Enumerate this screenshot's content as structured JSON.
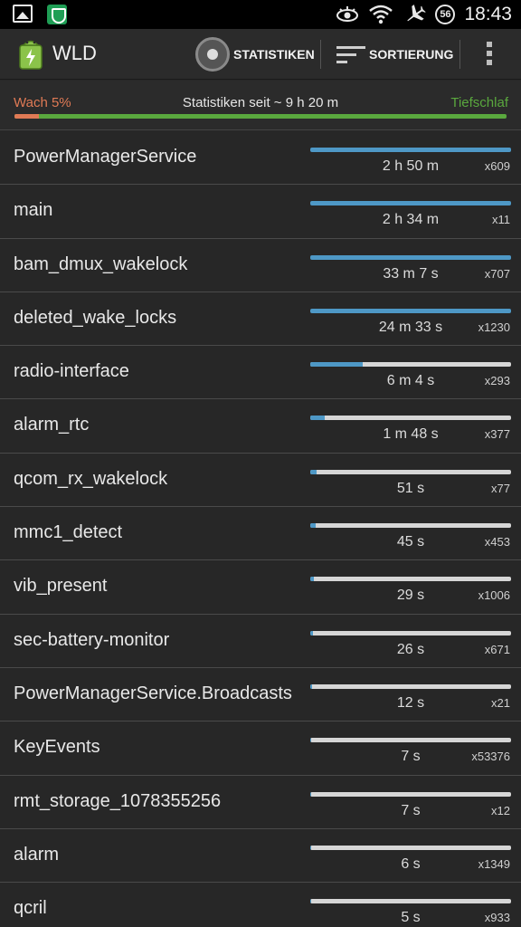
{
  "status_bar": {
    "time": "18:43",
    "badge": "56",
    "icons": [
      "image-icon",
      "shield-app-icon",
      "eye-icon",
      "wifi-icon",
      "airplane-icon"
    ]
  },
  "action_bar": {
    "title": "WLD",
    "statistics_label": "STATISTIKEN",
    "sort_label": "SORTIERUNG",
    "icons": [
      "battery-app-icon",
      "disc-icon",
      "sort-icon",
      "overflow-menu-icon"
    ]
  },
  "summary": {
    "awake_label": "Wach 5%",
    "since_label": "Statistiken seit ~ 9 h 20 m",
    "deep_sleep_label": "Tiefschlaf",
    "awake_fraction": 0.05,
    "colors": {
      "awake": "#e07a55",
      "deep_sleep": "#5aa83e",
      "progress": "#4e98c6"
    }
  },
  "wakelocks": [
    {
      "name": "PowerManagerService",
      "time": "2 h 50 m",
      "count": "x609",
      "fraction": 1.0
    },
    {
      "name": "main",
      "time": "2 h 34 m",
      "count": "x11",
      "fraction": 1.0
    },
    {
      "name": "bam_dmux_wakelock",
      "time": "33 m 7 s",
      "count": "x707",
      "fraction": 1.0
    },
    {
      "name": "deleted_wake_locks",
      "time": "24 m 33 s",
      "count": "x1230",
      "fraction": 1.0
    },
    {
      "name": "radio-interface",
      "time": "6 m 4 s",
      "count": "x293",
      "fraction": 0.26
    },
    {
      "name": "alarm_rtc",
      "time": "1 m 48 s",
      "count": "x377",
      "fraction": 0.07
    },
    {
      "name": "qcom_rx_wakelock",
      "time": "51 s",
      "count": "x77",
      "fraction": 0.03
    },
    {
      "name": "mmc1_detect",
      "time": "45 s",
      "count": "x453",
      "fraction": 0.025
    },
    {
      "name": "vib_present",
      "time": "29 s",
      "count": "x1006",
      "fraction": 0.02
    },
    {
      "name": "sec-battery-monitor",
      "time": "26 s",
      "count": "x671",
      "fraction": 0.015
    },
    {
      "name": "PowerManagerService.Broadcasts",
      "time": "12 s",
      "count": "x21",
      "fraction": 0.008
    },
    {
      "name": "KeyEvents",
      "time": "7 s",
      "count": "x53376",
      "fraction": 0.004
    },
    {
      "name": "rmt_storage_1078355256",
      "time": "7 s",
      "count": "x12",
      "fraction": 0.004
    },
    {
      "name": "alarm",
      "time": "6 s",
      "count": "x1349",
      "fraction": 0.003
    },
    {
      "name": "qcril",
      "time": "5 s",
      "count": "x933",
      "fraction": 0.003
    }
  ]
}
